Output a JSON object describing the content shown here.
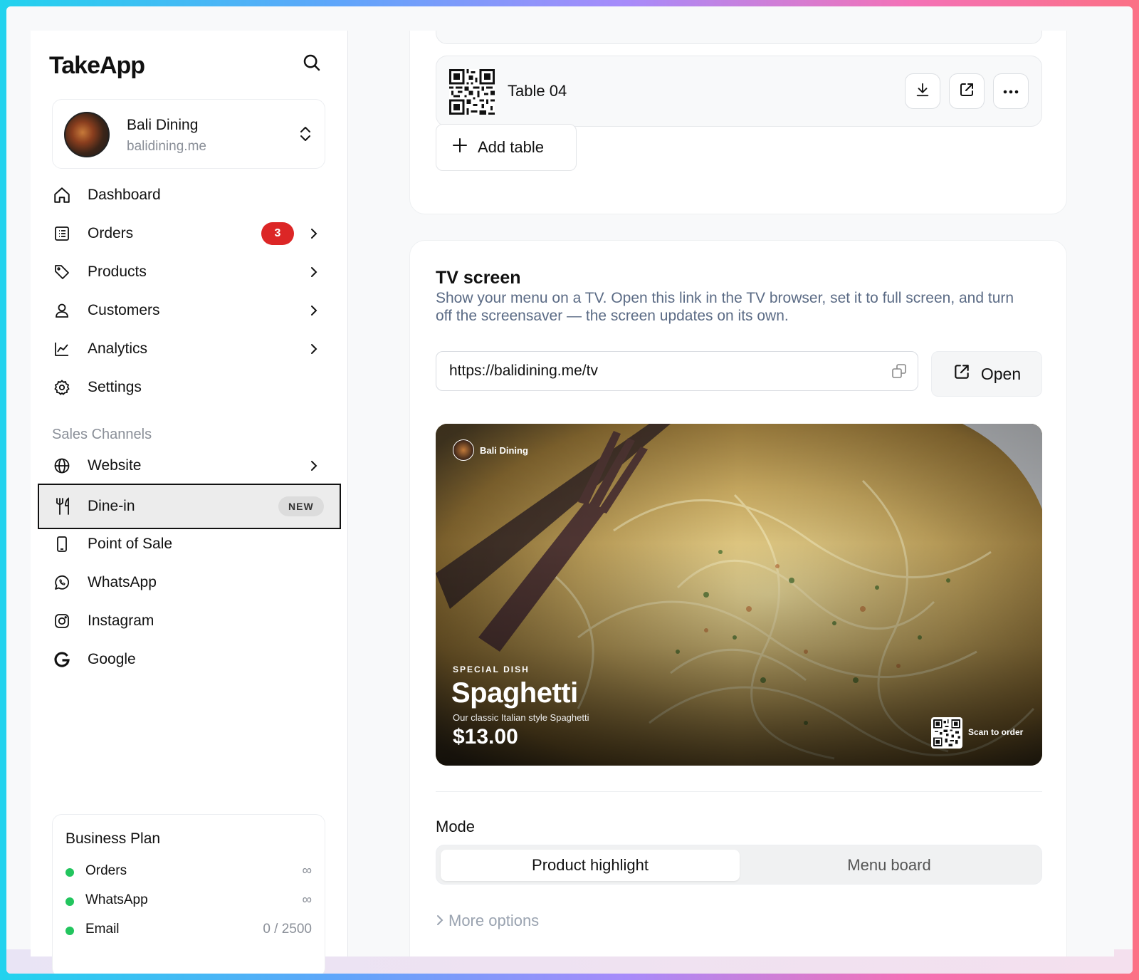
{
  "app": {
    "logo": "TakeApp"
  },
  "account": {
    "name": "Bali Dining",
    "domain": "balidining.me"
  },
  "nav": {
    "items": [
      {
        "label": "Dashboard",
        "icon": "home-icon"
      },
      {
        "label": "Orders",
        "icon": "orders-icon",
        "badge": "3"
      },
      {
        "label": "Products",
        "icon": "tag-icon"
      },
      {
        "label": "Customers",
        "icon": "user-icon"
      },
      {
        "label": "Analytics",
        "icon": "chart-icon"
      },
      {
        "label": "Settings",
        "icon": "gear-icon"
      }
    ],
    "section_label": "Sales Channels",
    "channels": [
      {
        "label": "Website",
        "icon": "globe-icon"
      },
      {
        "label": "Dine-in",
        "icon": "utensils-icon",
        "badge": "NEW",
        "active": true
      },
      {
        "label": "Point of Sale",
        "icon": "phone-icon"
      },
      {
        "label": "WhatsApp",
        "icon": "whatsapp-icon"
      },
      {
        "label": "Instagram",
        "icon": "instagram-icon"
      },
      {
        "label": "Google",
        "icon": "google-icon"
      }
    ]
  },
  "plan": {
    "title": "Business Plan",
    "rows": [
      {
        "label": "Orders",
        "value": "∞"
      },
      {
        "label": "WhatsApp",
        "value": "∞"
      },
      {
        "label": "Email",
        "value": "0 / 2500"
      }
    ]
  },
  "tables": {
    "row_name": "Table 04",
    "add_label": "Add table"
  },
  "tv": {
    "title": "TV screen",
    "description": "Show your menu on a TV. Open this link in the TV browser, set it to full screen, and turn off the screensaver — the screen updates on its own.",
    "url": "https://balidining.me/tv",
    "open_label": "Open",
    "preview": {
      "brand": "Bali Dining",
      "kicker": "SPECIAL DISH",
      "dish": "Spaghetti",
      "subtitle": "Our classic Italian style Spaghetti",
      "price": "$13.00",
      "scan": "Scan to order"
    },
    "mode_label": "Mode",
    "modes": [
      "Product highlight",
      "Menu board"
    ],
    "selected_mode": "Product highlight",
    "more_options": "More options"
  },
  "colors": {
    "accent_red": "#dc2626",
    "status_green": "#22c55e",
    "muted_text": "#5b6b85"
  }
}
